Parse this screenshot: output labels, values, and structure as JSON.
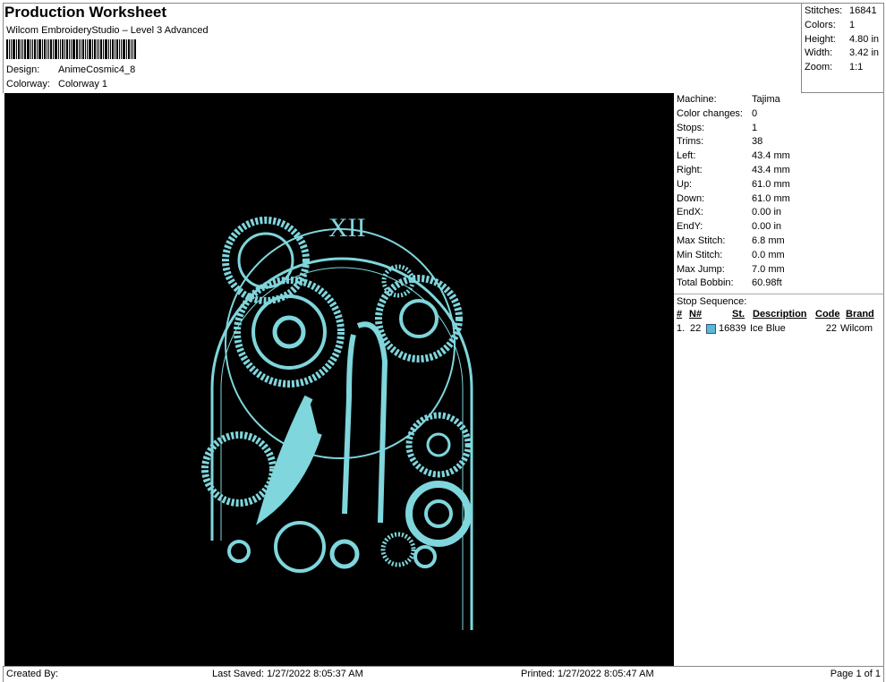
{
  "header": {
    "title": "Production Worksheet",
    "subtitle": "Wilcom EmbroideryStudio – Level 3 Advanced",
    "design_label": "Design:",
    "design_value": "AnimeCosmic4_8",
    "colorway_label": "Colorway:",
    "colorway_value": "Colorway 1"
  },
  "stats": [
    {
      "k": "Stitches:",
      "v": "16841"
    },
    {
      "k": "Colors:",
      "v": "1"
    },
    {
      "k": "Height:",
      "v": "4.80 in"
    },
    {
      "k": "Width:",
      "v": "3.42 in"
    },
    {
      "k": "Zoom:",
      "v": "1:1"
    }
  ],
  "machine": [
    {
      "k": "Machine:",
      "v": "Tajima"
    },
    {
      "k": "Color changes:",
      "v": "0"
    },
    {
      "k": "Stops:",
      "v": "1"
    },
    {
      "k": "Trims:",
      "v": "38"
    },
    {
      "k": "Left:",
      "v": "43.4 mm"
    },
    {
      "k": "Right:",
      "v": "43.4 mm"
    },
    {
      "k": "Up:",
      "v": "61.0 mm"
    },
    {
      "k": "Down:",
      "v": "61.0 mm"
    },
    {
      "k": "EndX:",
      "v": "0.00 in"
    },
    {
      "k": "EndY:",
      "v": "0.00 in"
    },
    {
      "k": "Max Stitch:",
      "v": "6.8 mm"
    },
    {
      "k": "Min Stitch:",
      "v": "0.0 mm"
    },
    {
      "k": "Max Jump:",
      "v": "7.0 mm"
    },
    {
      "k": "Total Bobbin:",
      "v": "60.98ft"
    }
  ],
  "stop_sequence": {
    "label": "Stop Sequence:",
    "columns": [
      "#",
      "N#",
      "St.",
      "Description",
      "Code",
      "Brand"
    ],
    "rows": [
      {
        "num": "1.",
        "n": "22",
        "color": "#5ab8d8",
        "st": "16839",
        "desc": "Ice Blue",
        "code": "22",
        "brand": "Wilcom"
      }
    ]
  },
  "thread_color": "#7fd6dc",
  "footer": {
    "created": "Created By:",
    "saved": "Last Saved: 1/27/2022 8:05:37 AM",
    "printed": "Printed: 1/27/2022 8:05:47 AM",
    "page": "Page 1 of 1"
  }
}
